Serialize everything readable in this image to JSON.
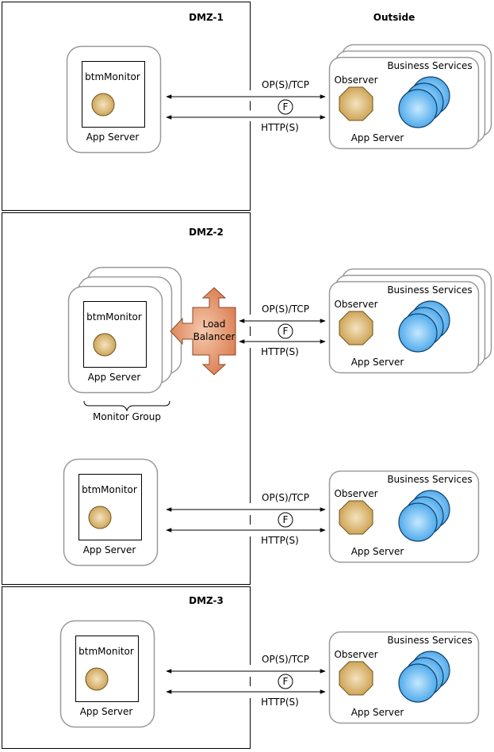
{
  "zones": {
    "dmz1": "DMZ-1",
    "dmz2": "DMZ-2",
    "dmz3": "DMZ-3",
    "outside": "Outside"
  },
  "labels": {
    "btm_monitor": "btmMonitor",
    "app_server": "App Server",
    "observer": "Observer",
    "business_services": "Business Services",
    "op_tcp": "OP(S)/TCP",
    "http": "HTTP(S)",
    "firewall": "F",
    "load_balancer_line1": "Load",
    "load_balancer_line2": "Balancer",
    "monitor_group": "Monitor Group"
  },
  "colors": {
    "monitor": "#d9b56a",
    "observer": "#d9b56a",
    "service": "#5ab4f0",
    "load_balancer": "#e69a72",
    "border": "#999999"
  }
}
